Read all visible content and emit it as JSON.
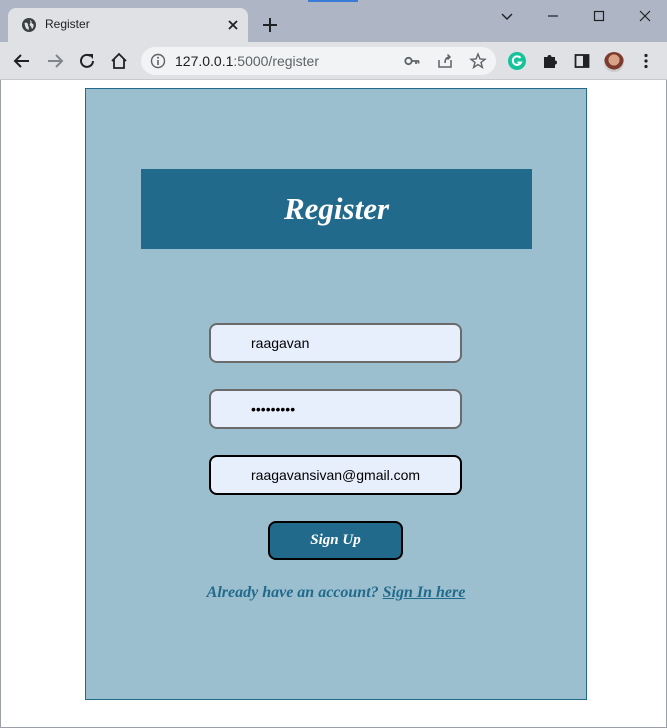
{
  "browser": {
    "tab_title": "Register",
    "url_host": "127.0.0.1",
    "url_path": ":5000/register"
  },
  "page": {
    "heading": "Register",
    "username_value": "raagavan",
    "password_value": "password1",
    "email_value": "raagavansivan@gmail.com",
    "signup_label": "Sign Up",
    "signin_prompt": "Already have an account?",
    "signin_link": "Sign In here"
  },
  "colors": {
    "card_bg": "#9bbfce",
    "accent": "#216a8c",
    "input_bg": "#e8effc"
  }
}
